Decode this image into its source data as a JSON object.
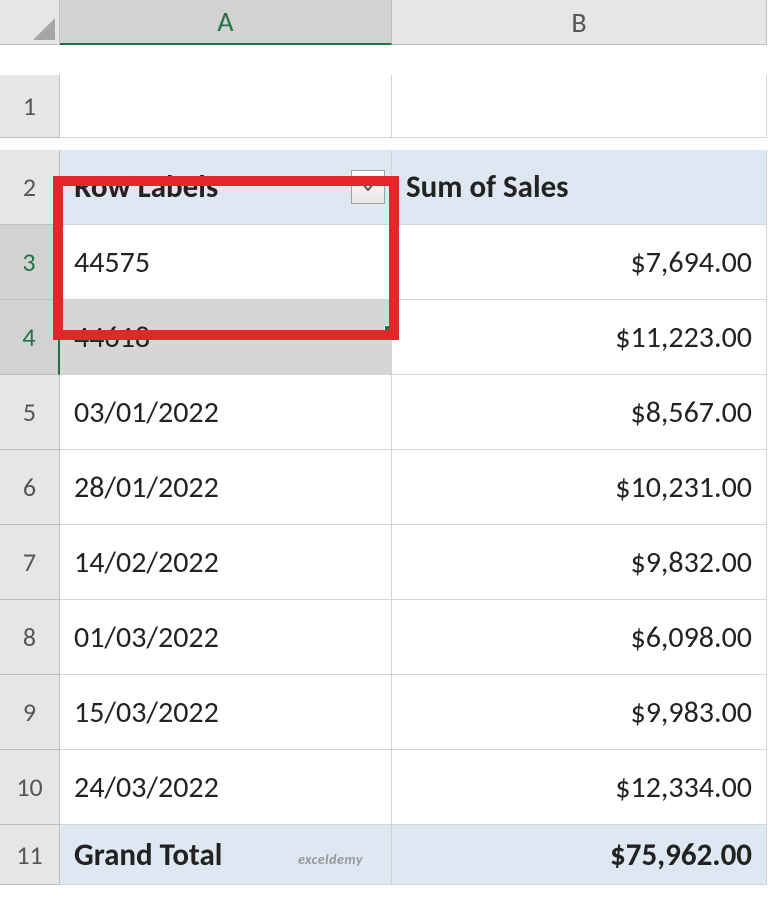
{
  "columns": {
    "A": "A",
    "B": "B"
  },
  "row_numbers": [
    1,
    2,
    3,
    4,
    5,
    6,
    7,
    8,
    9,
    10,
    11
  ],
  "pivot": {
    "header": {
      "row_labels": "Row Labels",
      "sum_of_sales": "Sum of Sales"
    },
    "rows": [
      {
        "label": "44575",
        "value": "$7,694.00"
      },
      {
        "label": "44618",
        "value": "$11,223.00"
      },
      {
        "label": "03/01/2022",
        "value": "$8,567.00"
      },
      {
        "label": "28/01/2022",
        "value": "$10,231.00"
      },
      {
        "label": "14/02/2022",
        "value": "$9,832.00"
      },
      {
        "label": "01/03/2022",
        "value": "$6,098.00"
      },
      {
        "label": "15/03/2022",
        "value": "$9,983.00"
      },
      {
        "label": "24/03/2022",
        "value": "$12,334.00"
      }
    ],
    "grand_total": {
      "label": "Grand Total",
      "value": "$75,962.00"
    }
  },
  "watermark": "exceldemy"
}
